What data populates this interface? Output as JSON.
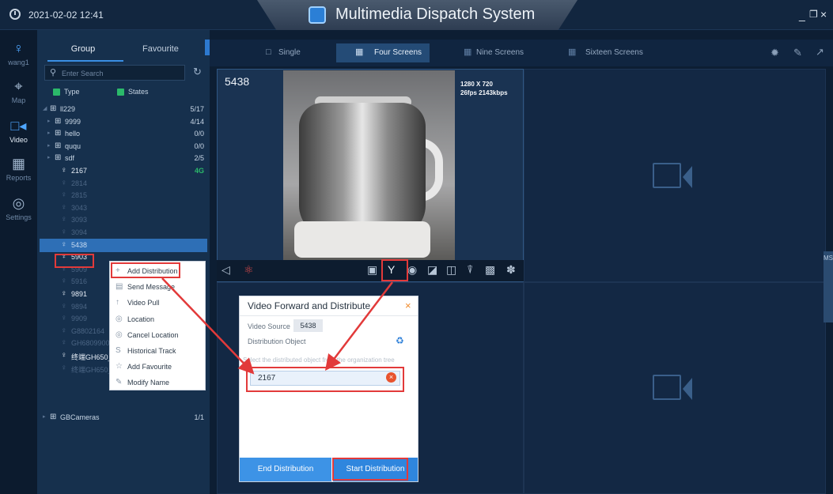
{
  "header": {
    "datetime": "2021-02-02 12:41",
    "title": "Multimedia Dispatch System",
    "min": "_",
    "max": "Ɖ",
    "close": "×"
  },
  "nav": [
    {
      "label": "wang1",
      "icon": "user-icon",
      "glyph": "♀"
    },
    {
      "label": "Map",
      "icon": "map-pin-icon",
      "glyph": "⌖"
    },
    {
      "label": "Video",
      "icon": "video-icon",
      "glyph": "□◂"
    },
    {
      "label": "Reports",
      "icon": "grid-icon",
      "glyph": "▦"
    },
    {
      "label": "Settings",
      "icon": "settings-icon",
      "glyph": "◎"
    }
  ],
  "panel": {
    "tab_group": "Group",
    "tab_favourite": "Favourite",
    "search_placeholder": "Enter Search",
    "filter_type": "Type",
    "filter_states": "States"
  },
  "tree": [
    {
      "label": "ll229",
      "count": "5/17",
      "kind": "group"
    },
    {
      "label": "9999",
      "count": "4/14",
      "kind": "group"
    },
    {
      "label": "hello",
      "count": "0/0",
      "kind": "group"
    },
    {
      "label": "ququ",
      "count": "0/0",
      "kind": "group"
    },
    {
      "label": "sdf",
      "count": "2/5",
      "kind": "group"
    },
    {
      "label": "2167",
      "count": "4G",
      "kind": "online"
    },
    {
      "label": "2814",
      "count": "",
      "kind": "offline"
    },
    {
      "label": "2815",
      "count": "",
      "kind": "offline"
    },
    {
      "label": "3043",
      "count": "",
      "kind": "offline"
    },
    {
      "label": "3093",
      "count": "",
      "kind": "offline"
    },
    {
      "label": "3094",
      "count": "",
      "kind": "offline"
    },
    {
      "label": "5438",
      "count": "",
      "kind": "selected"
    },
    {
      "label": "5903",
      "count": "",
      "kind": "online"
    },
    {
      "label": "5909",
      "count": "",
      "kind": "offline"
    },
    {
      "label": "5916",
      "count": "",
      "kind": "offline"
    },
    {
      "label": "9891",
      "count": "",
      "kind": "online"
    },
    {
      "label": "9894",
      "count": "",
      "kind": "offline"
    },
    {
      "label": "9909",
      "count": "",
      "kind": "offline"
    },
    {
      "label": "G8802164",
      "count": "",
      "kind": "offline"
    },
    {
      "label": "GH6809900",
      "count": "",
      "kind": "offline"
    },
    {
      "label": "终端GH650_2",
      "count": "",
      "kind": "online"
    },
    {
      "label": "终端GH650_2712",
      "count": "",
      "kind": "offline"
    },
    {
      "label": "GBCameras",
      "count": "1/1",
      "kind": "group"
    }
  ],
  "layouts": {
    "single": "Single",
    "four": "Four Screens",
    "nine": "Nine Screens",
    "sixteen": "Sixteen Screens"
  },
  "video": {
    "cell1_name": "5438",
    "resolution": "1280 X 720",
    "stats": "26fps 2143kbps"
  },
  "msg_tab": "MSG",
  "context_menu": [
    {
      "label": "Add Distribution",
      "icon": "plus-icon",
      "glyph": "+"
    },
    {
      "label": "Send Message",
      "icon": "message-icon",
      "glyph": "▤"
    },
    {
      "label": "Video Pull",
      "icon": "pull-icon",
      "glyph": "↑"
    },
    {
      "label": "Location",
      "icon": "location-icon",
      "glyph": "◎"
    },
    {
      "label": "Cancel Location",
      "icon": "cancel-location-icon",
      "glyph": "◎"
    },
    {
      "label": "Historical Track",
      "icon": "track-icon",
      "glyph": "S"
    },
    {
      "label": "Add Favourite",
      "icon": "star-icon",
      "glyph": "☆"
    },
    {
      "label": "Modify Name",
      "icon": "pencil-icon",
      "glyph": "✎"
    }
  ],
  "dialog": {
    "title": "Video Forward and Distribute",
    "close": "×",
    "source_label": "Video Source",
    "source_value": "5438",
    "object_label": "Distribution Object",
    "hint": "Select the distributed object from the organization tree",
    "items": [
      "2167"
    ],
    "end_button": "End Distribution",
    "start_button": "Start Distribution"
  },
  "colors": {
    "accent": "#2f86de",
    "highlight": "#e23a3a",
    "online_4g": "#2bb96a"
  }
}
